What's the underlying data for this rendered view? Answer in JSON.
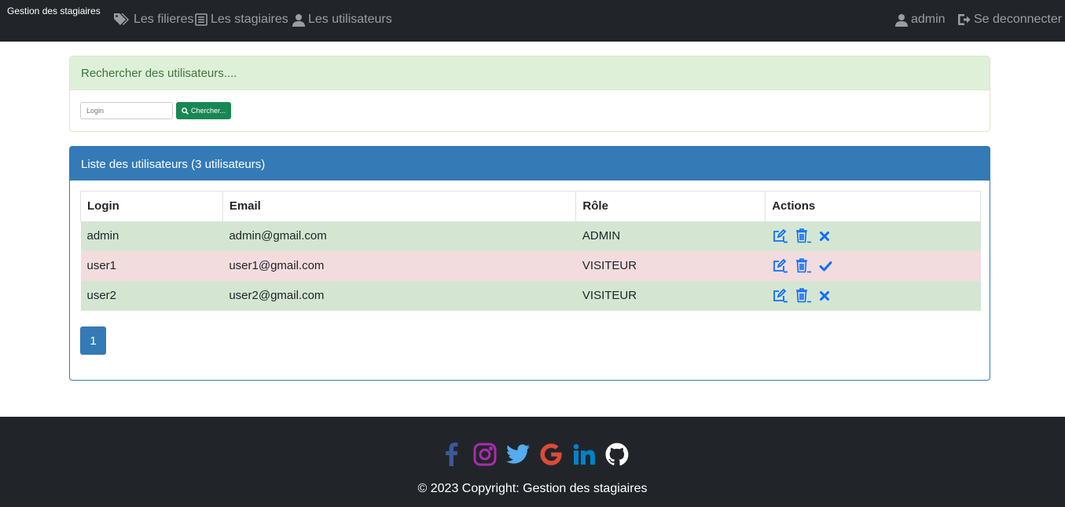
{
  "navbar": {
    "brand": "Gestion des stagiaires",
    "links": [
      {
        "label": "Les filieres",
        "icon": "tags-icon"
      },
      {
        "label": "Les stagiaires",
        "icon": "list-icon"
      },
      {
        "label": "Les utilisateurs",
        "icon": "user-icon"
      }
    ],
    "user": {
      "label": "admin",
      "icon": "user-icon"
    },
    "logout": {
      "label": "Se deconnecter",
      "icon": "logout-icon"
    }
  },
  "search": {
    "heading": "Rechercher des utilisateurs....",
    "placeholder": "Login",
    "button": "Chercher..."
  },
  "users": {
    "heading": "Liste des utilisateurs (3 utilisateurs)",
    "columns": [
      "Login",
      "Email",
      "Rôle",
      "Actions"
    ],
    "rows": [
      {
        "login": "admin",
        "email": "admin@gmail.com",
        "role": "ADMIN",
        "status": "active",
        "toggle_icon": "times-icon"
      },
      {
        "login": "user1",
        "email": "user1@gmail.com",
        "role": "VISITEUR",
        "status": "inactive",
        "toggle_icon": "check-icon"
      },
      {
        "login": "user2",
        "email": "user2@gmail.com",
        "role": "VISITEUR",
        "status": "active",
        "toggle_icon": "times-icon"
      }
    ],
    "current_page": "1"
  },
  "footer": {
    "social": [
      {
        "name": "facebook-icon",
        "color": "#3b5998"
      },
      {
        "name": "instagram-icon",
        "color": "#ac2bac"
      },
      {
        "name": "twitter-icon",
        "color": "#55acee"
      },
      {
        "name": "google-icon",
        "color": "#dd4b39"
      },
      {
        "name": "linkedin-icon",
        "color": "#0082ca"
      },
      {
        "name": "github-icon",
        "color": "#ffffff"
      }
    ],
    "copyright": "© 2023 Copyright: Gestion des stagiaires"
  },
  "colors": {
    "navbar_bg": "#212529",
    "success_heading_bg": "#dff0d8",
    "primary_heading_bg": "#337ab7",
    "row_success_bg": "#d4e6d2",
    "row_danger_bg": "#f2dcde",
    "action_icon": "#0d6efd",
    "search_button_bg": "#198754"
  }
}
